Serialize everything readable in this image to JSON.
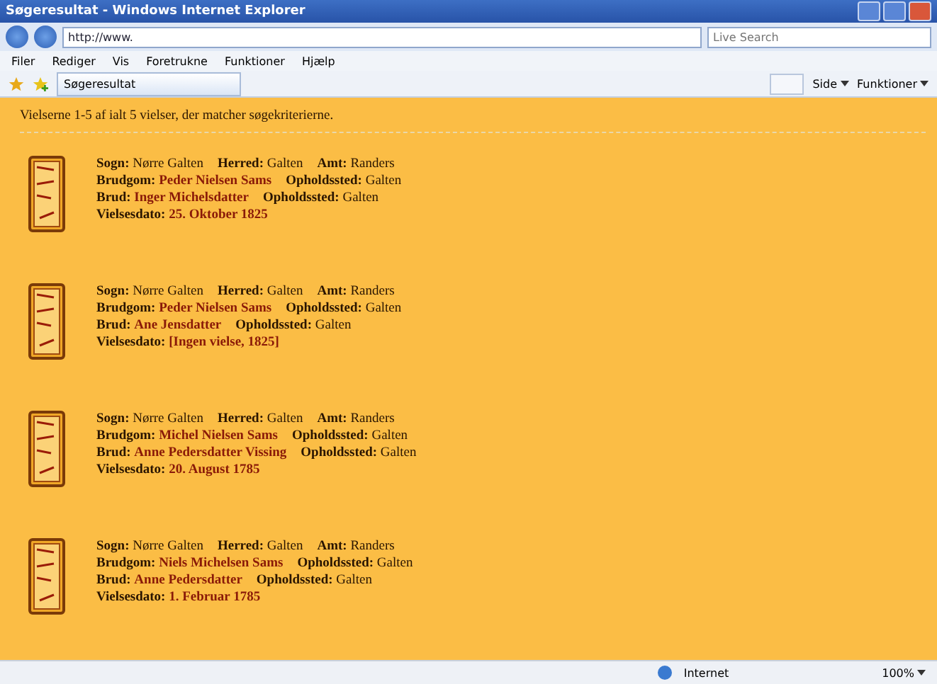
{
  "window": {
    "title": "Søgeresultat - Windows Internet Explorer"
  },
  "address_bar": {
    "value": "http://www."
  },
  "search": {
    "placeholder": "Live Search"
  },
  "menu": [
    "Filer",
    "Rediger",
    "Vis",
    "Foretrukne",
    "Funktioner",
    "Hjælp"
  ],
  "tabs": [
    {
      "label": "Søgeresultat",
      "selected": true
    }
  ],
  "toolbar": [
    "Side",
    "Funktioner"
  ],
  "summary": "Vielserne 1-5 af ialt 5 vielser, der matcher søgekriterierne.",
  "records": [
    {
      "lines": [
        [
          {
            "label": "Sogn:",
            "value": "Nørre Galten",
            "kind": "plain"
          },
          {
            "label": "Herred:",
            "value": "Galten",
            "kind": "plain"
          },
          {
            "label": "Amt:",
            "value": "Randers",
            "kind": "plain"
          }
        ],
        [
          {
            "label": "Brudgom:",
            "value": "Peder  Nielsen Sams",
            "kind": "name"
          },
          {
            "label": "Opholdssted:",
            "value": "Galten",
            "kind": "plain"
          }
        ],
        [
          {
            "label": "Brud:",
            "value": "Inger  Michelsdatter",
            "kind": "name"
          },
          {
            "label": "Opholdssted:",
            "value": "Galten",
            "kind": "plain"
          }
        ],
        [
          {
            "label": "Vielsesdato:",
            "value": "25. Oktober 1825",
            "kind": "name"
          }
        ]
      ]
    },
    {
      "lines": [
        [
          {
            "label": "Sogn:",
            "value": "Nørre Galten",
            "kind": "plain"
          },
          {
            "label": "Herred:",
            "value": "Galten",
            "kind": "plain"
          },
          {
            "label": "Amt:",
            "value": "Randers",
            "kind": "plain"
          }
        ],
        [
          {
            "label": "Brudgom:",
            "value": "Peder  Nielsen Sams",
            "kind": "name"
          },
          {
            "label": "Opholdssted:",
            "value": "Galten",
            "kind": "plain"
          }
        ],
        [
          {
            "label": "Brud:",
            "value": "Ane  Jensdatter",
            "kind": "name"
          },
          {
            "label": "Opholdssted:",
            "value": "Galten",
            "kind": "plain"
          }
        ],
        [
          {
            "label": "Vielsesdato:",
            "value": "[Ingen vielse, 1825]",
            "kind": "name"
          }
        ]
      ]
    },
    {
      "lines": [
        [
          {
            "label": "Sogn:",
            "value": "Nørre Galten",
            "kind": "plain"
          },
          {
            "label": "Herred:",
            "value": "Galten",
            "kind": "plain"
          },
          {
            "label": "Amt:",
            "value": "Randers",
            "kind": "plain"
          }
        ],
        [
          {
            "label": "Brudgom:",
            "value": "Michel  Nielsen Sams",
            "kind": "name"
          },
          {
            "label": "Opholdssted:",
            "value": "Galten",
            "kind": "plain"
          }
        ],
        [
          {
            "label": "Brud:",
            "value": "Anne  Pedersdatter Vissing",
            "kind": "name"
          },
          {
            "label": "Opholdssted:",
            "value": "Galten",
            "kind": "plain"
          }
        ],
        [
          {
            "label": "Vielsesdato:",
            "value": "20. August 1785",
            "kind": "name"
          }
        ]
      ]
    },
    {
      "lines": [
        [
          {
            "label": "Sogn:",
            "value": "Nørre Galten",
            "kind": "plain"
          },
          {
            "label": "Herred:",
            "value": "Galten",
            "kind": "plain"
          },
          {
            "label": "Amt:",
            "value": "Randers",
            "kind": "plain"
          }
        ],
        [
          {
            "label": "Brudgom:",
            "value": "Niels  Michelsen Sams",
            "kind": "name"
          },
          {
            "label": "Opholdssted:",
            "value": "Galten",
            "kind": "plain"
          }
        ],
        [
          {
            "label": "Brud:",
            "value": "Anne  Pedersdatter",
            "kind": "name"
          },
          {
            "label": "Opholdssted:",
            "value": "Galten",
            "kind": "plain"
          }
        ],
        [
          {
            "label": "Vielsesdato:",
            "value": "1. Februar 1785",
            "kind": "name"
          }
        ]
      ]
    }
  ],
  "status_bar": {
    "zone": "Internet",
    "zoom": "100%"
  }
}
